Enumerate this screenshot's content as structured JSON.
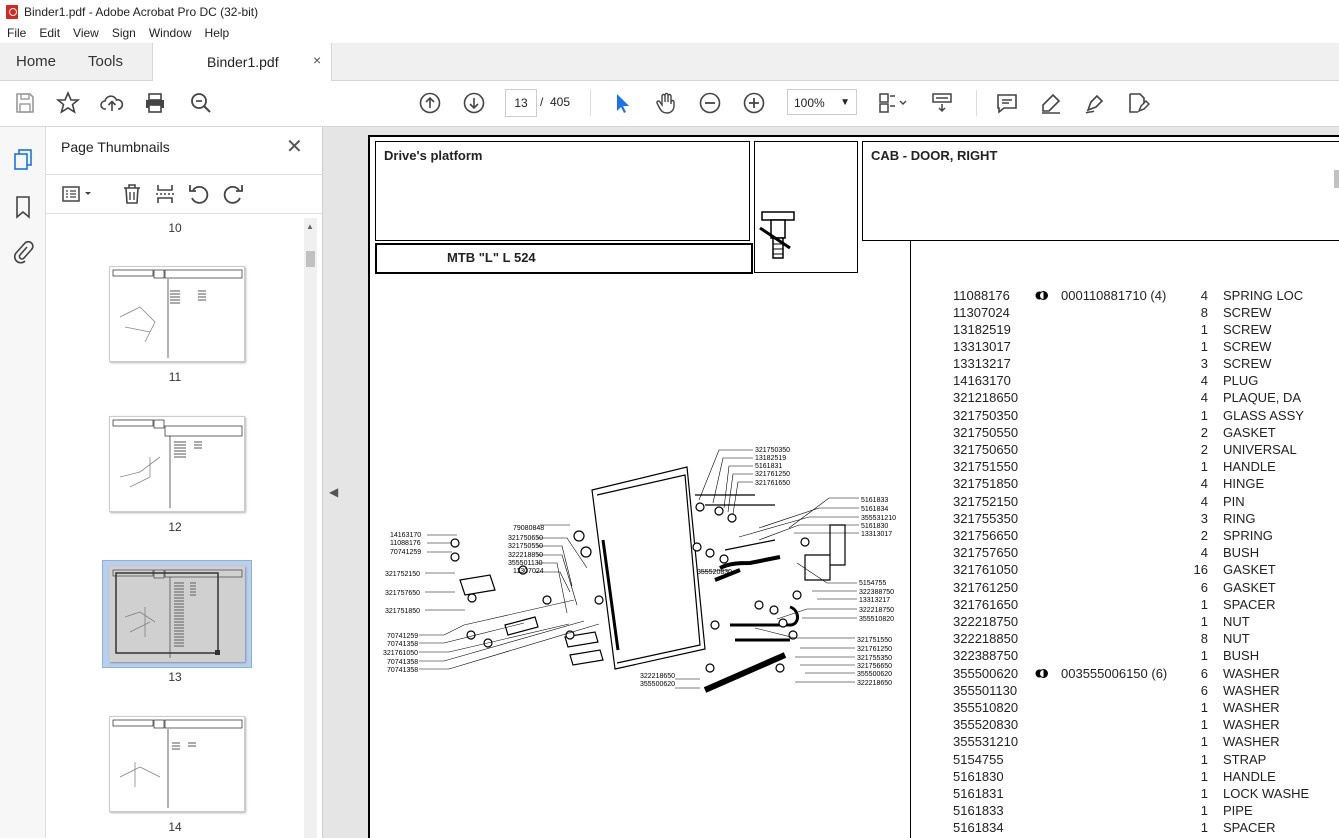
{
  "window": {
    "title": "Binder1.pdf - Adobe Acrobat Pro DC (32-bit)"
  },
  "menu": [
    "File",
    "Edit",
    "View",
    "Sign",
    "Window",
    "Help"
  ],
  "tabs": {
    "home": "Home",
    "tools": "Tools",
    "doc": "Binder1.pdf",
    "close": "×"
  },
  "toolbar": {
    "page_current": "13",
    "page_sep": "/",
    "page_total": "405",
    "zoom": "100%"
  },
  "panel": {
    "title": "Page Thumbnails",
    "close": "✕",
    "thumbs": [
      {
        "num": "10"
      },
      {
        "num": "11"
      },
      {
        "num": "12"
      },
      {
        "num": "13",
        "selected": true
      },
      {
        "num": "14"
      }
    ]
  },
  "document": {
    "section": "Drive's platform",
    "model": "MTB \"L\" L 524",
    "heading": "CAB - DOOR, RIGHT",
    "parts": [
      {
        "code": "11088176",
        "dot": true,
        "ref": "000110881710  (4)",
        "qty": "4",
        "desc": "SPRING LOC"
      },
      {
        "code": "11307024",
        "qty": "8",
        "desc": "SCREW"
      },
      {
        "code": "13182519",
        "qty": "1",
        "desc": "SCREW"
      },
      {
        "code": "13313017",
        "qty": "1",
        "desc": "SCREW"
      },
      {
        "code": "13313217",
        "qty": "3",
        "desc": "SCREW"
      },
      {
        "code": "14163170",
        "qty": "4",
        "desc": "PLUG"
      },
      {
        "code": "321218650",
        "qty": "4",
        "desc": "PLAQUE, DA"
      },
      {
        "code": "321750350",
        "qty": "1",
        "desc": "GLASS ASSY"
      },
      {
        "code": "321750550",
        "qty": "2",
        "desc": "GASKET"
      },
      {
        "code": "321750650",
        "qty": "2",
        "desc": "UNIVERSAL"
      },
      {
        "code": "321751550",
        "qty": "1",
        "desc": "HANDLE"
      },
      {
        "code": "321751850",
        "qty": "4",
        "desc": "HINGE"
      },
      {
        "code": "321752150",
        "qty": "4",
        "desc": "PIN"
      },
      {
        "code": "321755350",
        "qty": "3",
        "desc": "RING"
      },
      {
        "code": "321756650",
        "qty": "2",
        "desc": "SPRING"
      },
      {
        "code": "321757650",
        "qty": "4",
        "desc": "BUSH"
      },
      {
        "code": "321761050",
        "qty": "16",
        "desc": "GASKET"
      },
      {
        "code": "321761250",
        "qty": "6",
        "desc": "GASKET"
      },
      {
        "code": "321761650",
        "qty": "1",
        "desc": "SPACER"
      },
      {
        "code": "322218750",
        "qty": "1",
        "desc": "NUT"
      },
      {
        "code": "322218850",
        "qty": "8",
        "desc": "NUT"
      },
      {
        "code": "322388750",
        "qty": "1",
        "desc": "BUSH"
      },
      {
        "code": "355500620",
        "dot": true,
        "ref": "003555006150  (6)",
        "qty": "6",
        "desc": "WASHER"
      },
      {
        "code": "355501130",
        "qty": "6",
        "desc": "WASHER"
      },
      {
        "code": "355510820",
        "qty": "1",
        "desc": "WASHER"
      },
      {
        "code": "355520830",
        "qty": "1",
        "desc": "WASHER"
      },
      {
        "code": "355531210",
        "qty": "1",
        "desc": "WASHER"
      },
      {
        "code": "5154755",
        "qty": "1",
        "desc": "STRAP"
      },
      {
        "code": "5161830",
        "qty": "1",
        "desc": "HANDLE"
      },
      {
        "code": "5161831",
        "qty": "1",
        "desc": "LOCK WASHE"
      },
      {
        "code": "5161833",
        "qty": "1",
        "desc": "PIPE"
      },
      {
        "code": "5161834",
        "qty": "1",
        "desc": "SPACER"
      }
    ],
    "diagram_labels": {
      "top_right": [
        "321750350",
        "13182519",
        "5161831",
        "321761250",
        "321761650"
      ],
      "right": [
        "5161833",
        "5161834",
        "355531210",
        "5161830",
        "13313017"
      ],
      "right_lower": [
        "5154755",
        "322388750",
        "13313217",
        "322218750",
        "355510820"
      ],
      "bottom_right": [
        "321751550",
        "321761250",
        "321755350",
        "321756650",
        "355500620",
        "322218650"
      ],
      "left_top": [
        "14163170",
        "11088176",
        "70741259"
      ],
      "left_mid": [
        "79080848",
        "321750650",
        "321750550",
        "322218850",
        "355501130",
        "11307024"
      ],
      "left": [
        "321752150",
        "321757650",
        "321751850"
      ],
      "left_bottom": [
        "70741259",
        "70741358",
        "321761050",
        "70741358",
        "70741358"
      ],
      "center": [
        "355520830"
      ],
      "bottom": [
        "322218650",
        "355500620"
      ]
    }
  }
}
